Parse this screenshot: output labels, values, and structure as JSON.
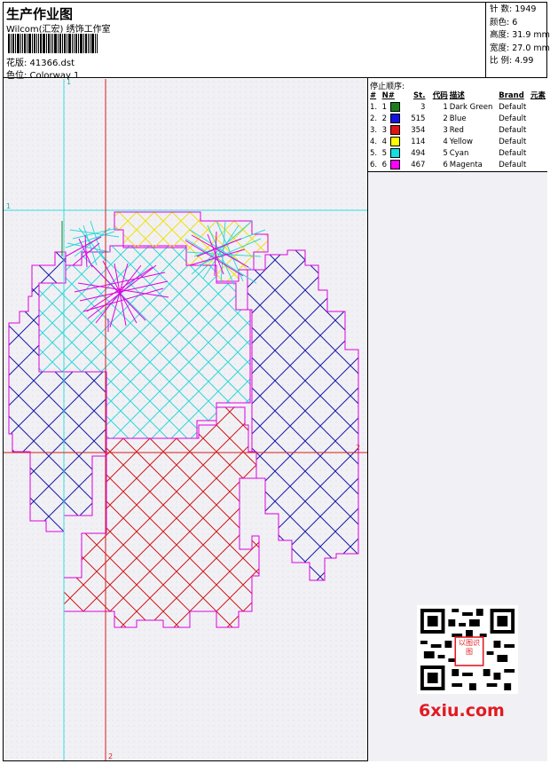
{
  "header": {
    "title": "生产作业图",
    "studio": "Wilcom(汇宏) 绣饰工作室",
    "file_label": "花版: 41366.dst",
    "colorway_label": "色位: Colorway 1"
  },
  "stats": {
    "stitches": "针 数: 1949",
    "colors": "颜色: 6",
    "height": "高度: 31.9 mm",
    "width": "宽度: 27.0 mm",
    "scale": "比 例: 4.99"
  },
  "design": {
    "guide_label_top": "1",
    "guide_label_left": "1",
    "guide_label_bottom": "2",
    "guide_label_right": "2"
  },
  "stop_order": {
    "title": "停止顺序:",
    "headers": [
      "#",
      "N#",
      "St.",
      "代码",
      "描述",
      "Brand",
      "元素"
    ],
    "rows": [
      {
        "num": "1.",
        "n": "1",
        "swatch": "#1a7f1a",
        "st": "3",
        "code": "1",
        "desc": "Dark Green",
        "brand": "Default"
      },
      {
        "num": "2.",
        "n": "2",
        "swatch": "#1414e0",
        "st": "515",
        "code": "2",
        "desc": "Blue",
        "brand": "Default"
      },
      {
        "num": "3.",
        "n": "3",
        "swatch": "#e01414",
        "st": "354",
        "code": "3",
        "desc": "Red",
        "brand": "Default"
      },
      {
        "num": "4.",
        "n": "4",
        "swatch": "#ffff00",
        "st": "114",
        "code": "4",
        "desc": "Yellow",
        "brand": "Default"
      },
      {
        "num": "5.",
        "n": "5",
        "swatch": "#10e0e0",
        "st": "494",
        "code": "5",
        "desc": "Cyan",
        "brand": "Default"
      },
      {
        "num": "6.",
        "n": "6",
        "swatch": "#ff00ff",
        "st": "467",
        "code": "6",
        "desc": "Magenta",
        "brand": "Default"
      }
    ]
  },
  "watermark": {
    "text": "6xiu.com",
    "badge": "以图识图"
  },
  "colors": {
    "guide_cyan": "#33e0e0",
    "guide_red": "#d81c1c",
    "outline_magenta": "#e000e0"
  }
}
